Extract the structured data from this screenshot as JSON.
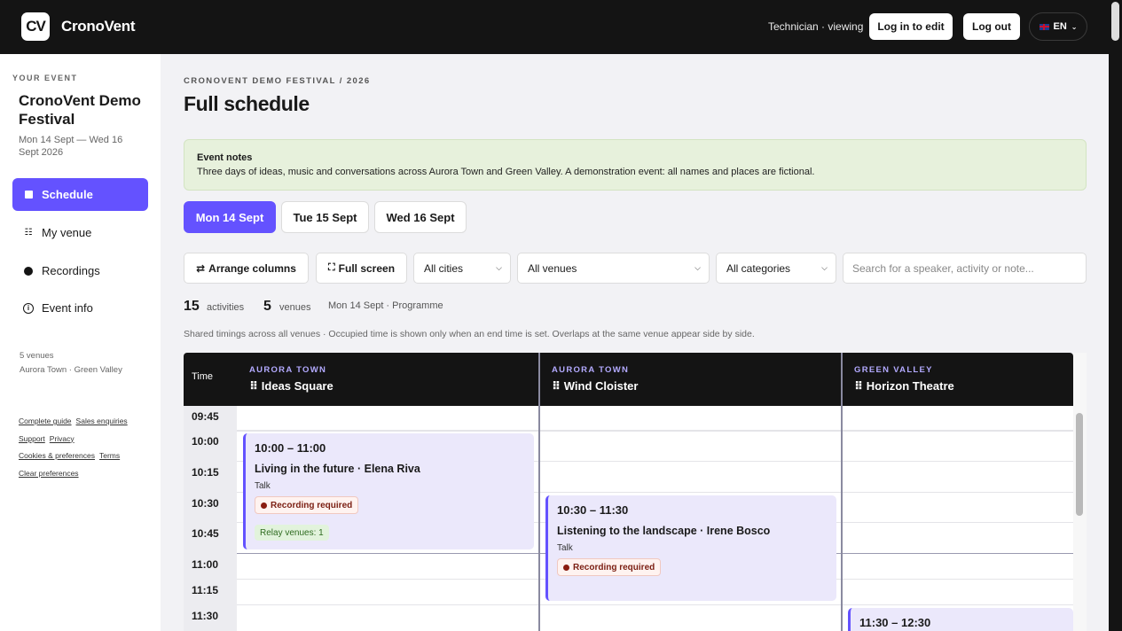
{
  "header": {
    "logo_mark": "CV",
    "app_name": "CronoVent",
    "role_text": "Technician · viewing",
    "login_label": "Log in to edit",
    "logout_label": "Log out",
    "lang_label": "EN"
  },
  "sidebar": {
    "kicker": "YOUR EVENT",
    "event_title": "CronoVent Demo Festival",
    "dates": "Mon 14 Sept — Wed 16 Sept 2026",
    "nav": [
      {
        "label": "Schedule",
        "icon": "grid-square-icon",
        "active": true
      },
      {
        "label": "My venue",
        "icon": "list-icon"
      },
      {
        "label": "Recordings",
        "icon": "record-dot-icon"
      },
      {
        "label": "Event info",
        "icon": "info-icon"
      }
    ],
    "venue_count": "5 venues",
    "venue_cities": "Aurora Town · Green Valley",
    "links": {
      "guide": "Complete guide",
      "sales": "Sales enquiries",
      "support": "Support",
      "privacy": "Privacy",
      "cookies": "Cookies & preferences",
      "terms": "Terms",
      "clear": "Clear preferences"
    }
  },
  "main": {
    "breadcrumb": "CRONOVENT DEMO FESTIVAL / 2026",
    "title": "Full schedule",
    "notes": {
      "title": "Event notes",
      "body": "Three days of ideas, music and conversations across Aurora Town and Green Valley. A demonstration event: all names and places are fictional."
    },
    "days": [
      "Mon 14 Sept",
      "Tue 15 Sept",
      "Wed 16 Sept"
    ],
    "controls": {
      "arrange": "Arrange columns",
      "fullscreen": "Full screen",
      "cities": "All cities",
      "venues": "All venues",
      "categories": "All categories",
      "search_placeholder": "Search for a speaker, activity or note..."
    },
    "stats": {
      "activities_count": "15",
      "activities_label": "activities",
      "venues_count": "5",
      "venues_label": "venues",
      "meta": "Mon 14 Sept · Programme"
    },
    "hint": "Shared timings across all venues · Occupied time is shown only when an end time is set. Overlaps at the same venue appear side by side."
  },
  "grid": {
    "time_header": "Time",
    "columns": [
      {
        "city": "AURORA TOWN",
        "venue": "Ideas Square"
      },
      {
        "city": "AURORA TOWN",
        "venue": "Wind Cloister"
      },
      {
        "city": "GREEN VALLEY",
        "venue": "Horizon Theatre"
      }
    ],
    "times": [
      "09:45",
      "10:00",
      "10:15",
      "10:30",
      "10:45",
      "11:00",
      "11:15",
      "11:30"
    ],
    "events": [
      {
        "time": "10:00 – 11:00",
        "title": "Living in the future · Elena Riva",
        "type": "Talk",
        "badge": "Recording required",
        "relay": "Relay venues: 1"
      },
      {
        "time": "10:30 – 11:30",
        "title": "Listening to the landscape · Irene Bosco",
        "type": "Talk",
        "badge": "Recording required"
      },
      {
        "time": "11:30 – 12:30"
      }
    ]
  },
  "colors": {
    "accent": "#6452ff",
    "topbar": "#141414",
    "event_bg": "#ebe8fb",
    "notes_bg": "#e7f1dc",
    "recording_badge": "#7a1e12"
  }
}
